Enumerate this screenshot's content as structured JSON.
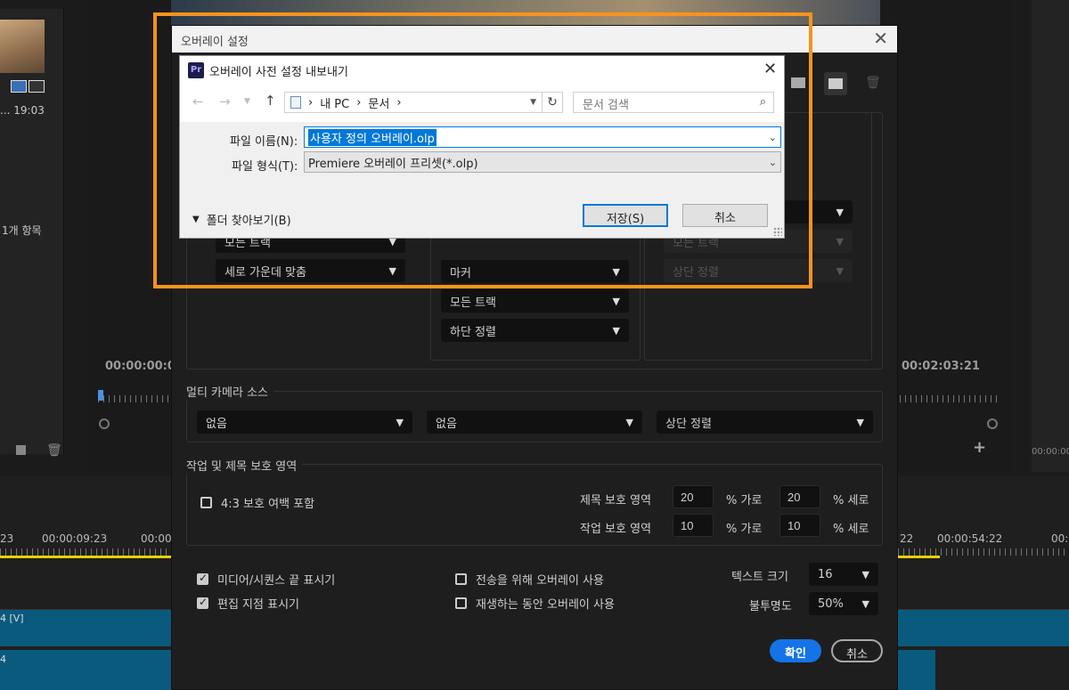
{
  "background": {
    "left_time": "... 19:03",
    "items_count": "1개 항목",
    "tc_left": "00:00:00:0",
    "tc_right": "00:02:03:21",
    "tl_labels": [
      "23",
      "00:00:09:23",
      "00:00",
      "22",
      "00:00:54:22",
      "00:0"
    ],
    "tracks": [
      "4 [V]",
      "4"
    ],
    "side_tc": "00:00:00"
  },
  "overlay_dialog": {
    "title": "오버레이 설정",
    "top_row": {
      "left": [
        "모든 트랙",
        "세로 가운데 맞춤"
      ],
      "center": [
        "마커",
        "모든 트랙",
        "하단 정렬"
      ],
      "right": [
        "모든 트랙",
        "상단 정렬"
      ]
    },
    "multicam": {
      "label": "멀티 카메라 소스",
      "selects": [
        "없음",
        "없음",
        "상단 정렬"
      ]
    },
    "safe": {
      "label": "작업 및 제목 보호 영역",
      "checkbox_43": "4:3 보호 여백 포함",
      "title_safe_label": "제목 보호 영역",
      "title_h": "20",
      "title_v": "20",
      "action_safe_label": "작업 보호 영역",
      "action_h": "10",
      "action_v": "10",
      "pct_h": "% 가로",
      "pct_v": "% 세로"
    },
    "options": {
      "media_end": "미디어/시퀀스 끝 표시기",
      "edit_point": "편집 지점 표시기",
      "transmit": "전송을 위해 오버레이 사용",
      "playback": "재생하는 동안 오버레이 사용",
      "text_size_label": "텍스트 크기",
      "text_size": "16",
      "opacity_label": "불투명도",
      "opacity": "50%"
    },
    "ok": "확인",
    "cancel": "취소"
  },
  "save_dialog": {
    "app_badge": "Pr",
    "title": "오버레이 사전 설정 내보내기",
    "path": [
      "내 PC",
      "문서"
    ],
    "search_placeholder": "문서 검색",
    "filename_label": "파일 이름(N):",
    "filename": "사용자 정의 오버레이.olp",
    "filetype_label": "파일 형식(T):",
    "filetype": "Premiere 오버레이 프리셋(*.olp)",
    "browse": "폴더 찾아보기(B)",
    "save": "저장(S)",
    "cancel": "취소"
  },
  "colors": {
    "highlight": "#f7931e",
    "accent": "#1473e6",
    "track": "#0a5a7e"
  }
}
